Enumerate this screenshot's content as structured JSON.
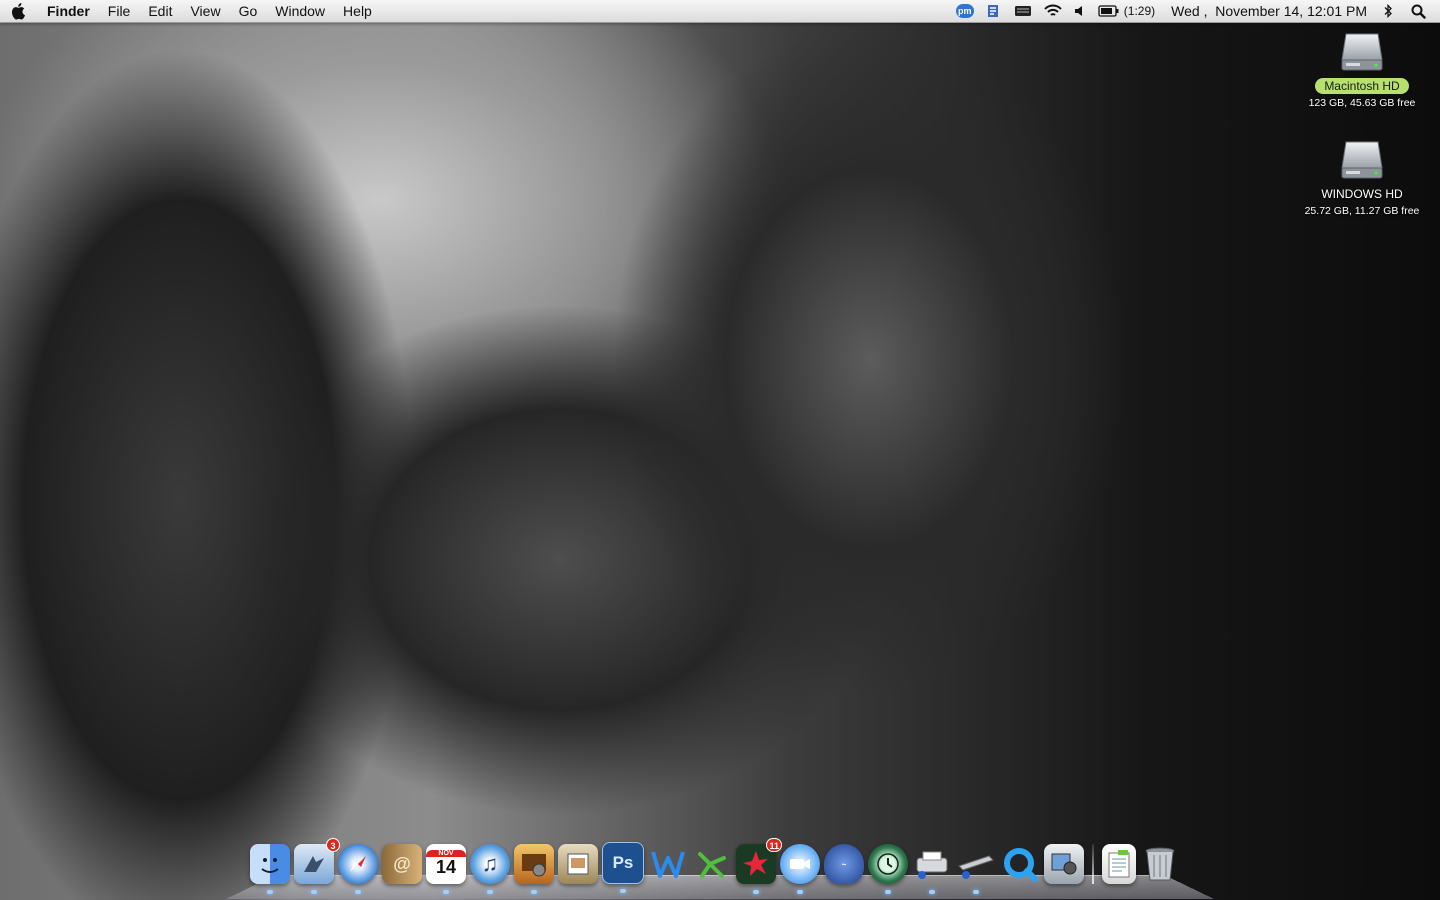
{
  "menubar": {
    "apple_icon": "apple-icon",
    "app_name": "Finder",
    "menus": [
      "File",
      "Edit",
      "View",
      "Go",
      "Window",
      "Help"
    ],
    "status": {
      "pm_label": "pm",
      "battery_time": "(1:29)",
      "clock": "Wed ,  November 14, 12:01 PM"
    }
  },
  "desktop": {
    "drives": [
      {
        "name": "Macintosh HD",
        "info": "123 GB, 45.63 GB free",
        "selected": true
      },
      {
        "name": "WINDOWS HD",
        "info": "25.72 GB, 11.27 GB free",
        "selected": false
      }
    ]
  },
  "dock": {
    "calendar": {
      "month": "NOV",
      "day": "14"
    },
    "mail_badge": "3",
    "app_badge": "11",
    "photoshop_label": "Ps",
    "items": [
      {
        "icon": "finder-icon",
        "color": "#4a8be6"
      },
      {
        "icon": "mail-icon",
        "color": "#7aa7d8"
      },
      {
        "icon": "safari-icon",
        "color": "#3b86d8"
      },
      {
        "icon": "address-book-icon",
        "color": "#c59a5c"
      },
      {
        "icon": "ical-icon",
        "color": "#ffffff"
      },
      {
        "icon": "itunes-icon",
        "color": "#5aa0e0"
      },
      {
        "icon": "iphoto-icon",
        "color": "#d89a3a"
      },
      {
        "icon": "preview-icon",
        "color": "#b9a06a"
      },
      {
        "icon": "photoshop-icon",
        "color": "#1e4f8f"
      },
      {
        "icon": "word-icon",
        "color": "#2a7bd3"
      },
      {
        "icon": "network-icon",
        "color": "#5fc04c"
      },
      {
        "icon": "flash-icon",
        "color": "#2b5a3a"
      },
      {
        "icon": "ichat-icon",
        "color": "#5aa6f0"
      },
      {
        "icon": "brain-icon",
        "color": "#2d5bb0"
      },
      {
        "icon": "time-machine-icon",
        "color": "#1f5b3a"
      },
      {
        "icon": "printer-icon",
        "color": "#cfd4da"
      },
      {
        "icon": "scanner-icon",
        "color": "#c9ced4"
      },
      {
        "icon": "quicktime-icon",
        "color": "#3aa0e6"
      },
      {
        "icon": "image-capture-icon",
        "color": "#a9b2ba"
      },
      {
        "icon": "documents-stack-icon",
        "color": "#f2f2f2"
      },
      {
        "icon": "trash-icon",
        "color": "#a0a6ad"
      }
    ]
  }
}
